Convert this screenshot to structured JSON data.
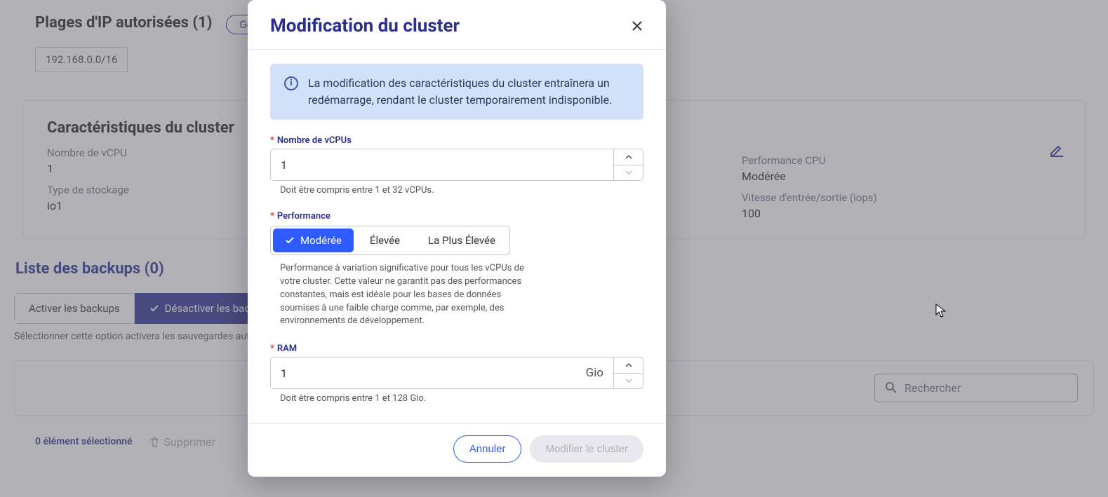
{
  "bg": {
    "ip_heading": "Plages d'IP autorisées (1)",
    "manage_btn": "Gérer",
    "ip_chip": "192.168.0.0/16",
    "card_title": "Caractéristiques du cluster",
    "vcpu_lbl": "Nombre de vCPU",
    "vcpu_val": "1",
    "storage_lbl": "Type de stockage",
    "storage_val": "io1",
    "perf_lbl": "Performance CPU",
    "perf_val": "Modérée",
    "iops_lbl": "Vitesse d'entrée/sortie (iops)",
    "iops_val": "100",
    "backups_head": "Liste des backups (0)",
    "enable_backups": "Activer les backups",
    "disable_backups": "Désactiver les backups",
    "helper": "Sélectionner cette option activera les sauvegardes automatiques",
    "search_placeholder": "Rechercher",
    "sel_count": "0 élément sélectionné",
    "delete": "Supprimer"
  },
  "modal": {
    "title": "Modification du cluster",
    "alert": "La modification des caractéristiques du cluster entraînera un redémarrage, rendant le cluster temporairement indisponible.",
    "vcpu_label": "Nombre de vCPUs",
    "vcpu_value": "1",
    "vcpu_hint": "Doit être compris entre 1 et 32 vCPUs.",
    "perf_label": "Performance",
    "perf_opts": {
      "mod": "Modérée",
      "high": "Élevée",
      "highest": "La Plus Élevée"
    },
    "perf_desc": "Performance à variation significative pour tous les vCPUs de votre cluster. Cette valeur ne garantit pas des performances constantes, mais est idéale pour les bases de données soumises à une faible charge comme, par exemple, des environnements de développement.",
    "ram_label": "RAM",
    "ram_value": "1",
    "ram_unit": "Gio",
    "ram_hint": "Doit être compris entre 1 et 128 Gio.",
    "cancel": "Annuler",
    "submit": "Modifier le cluster"
  }
}
